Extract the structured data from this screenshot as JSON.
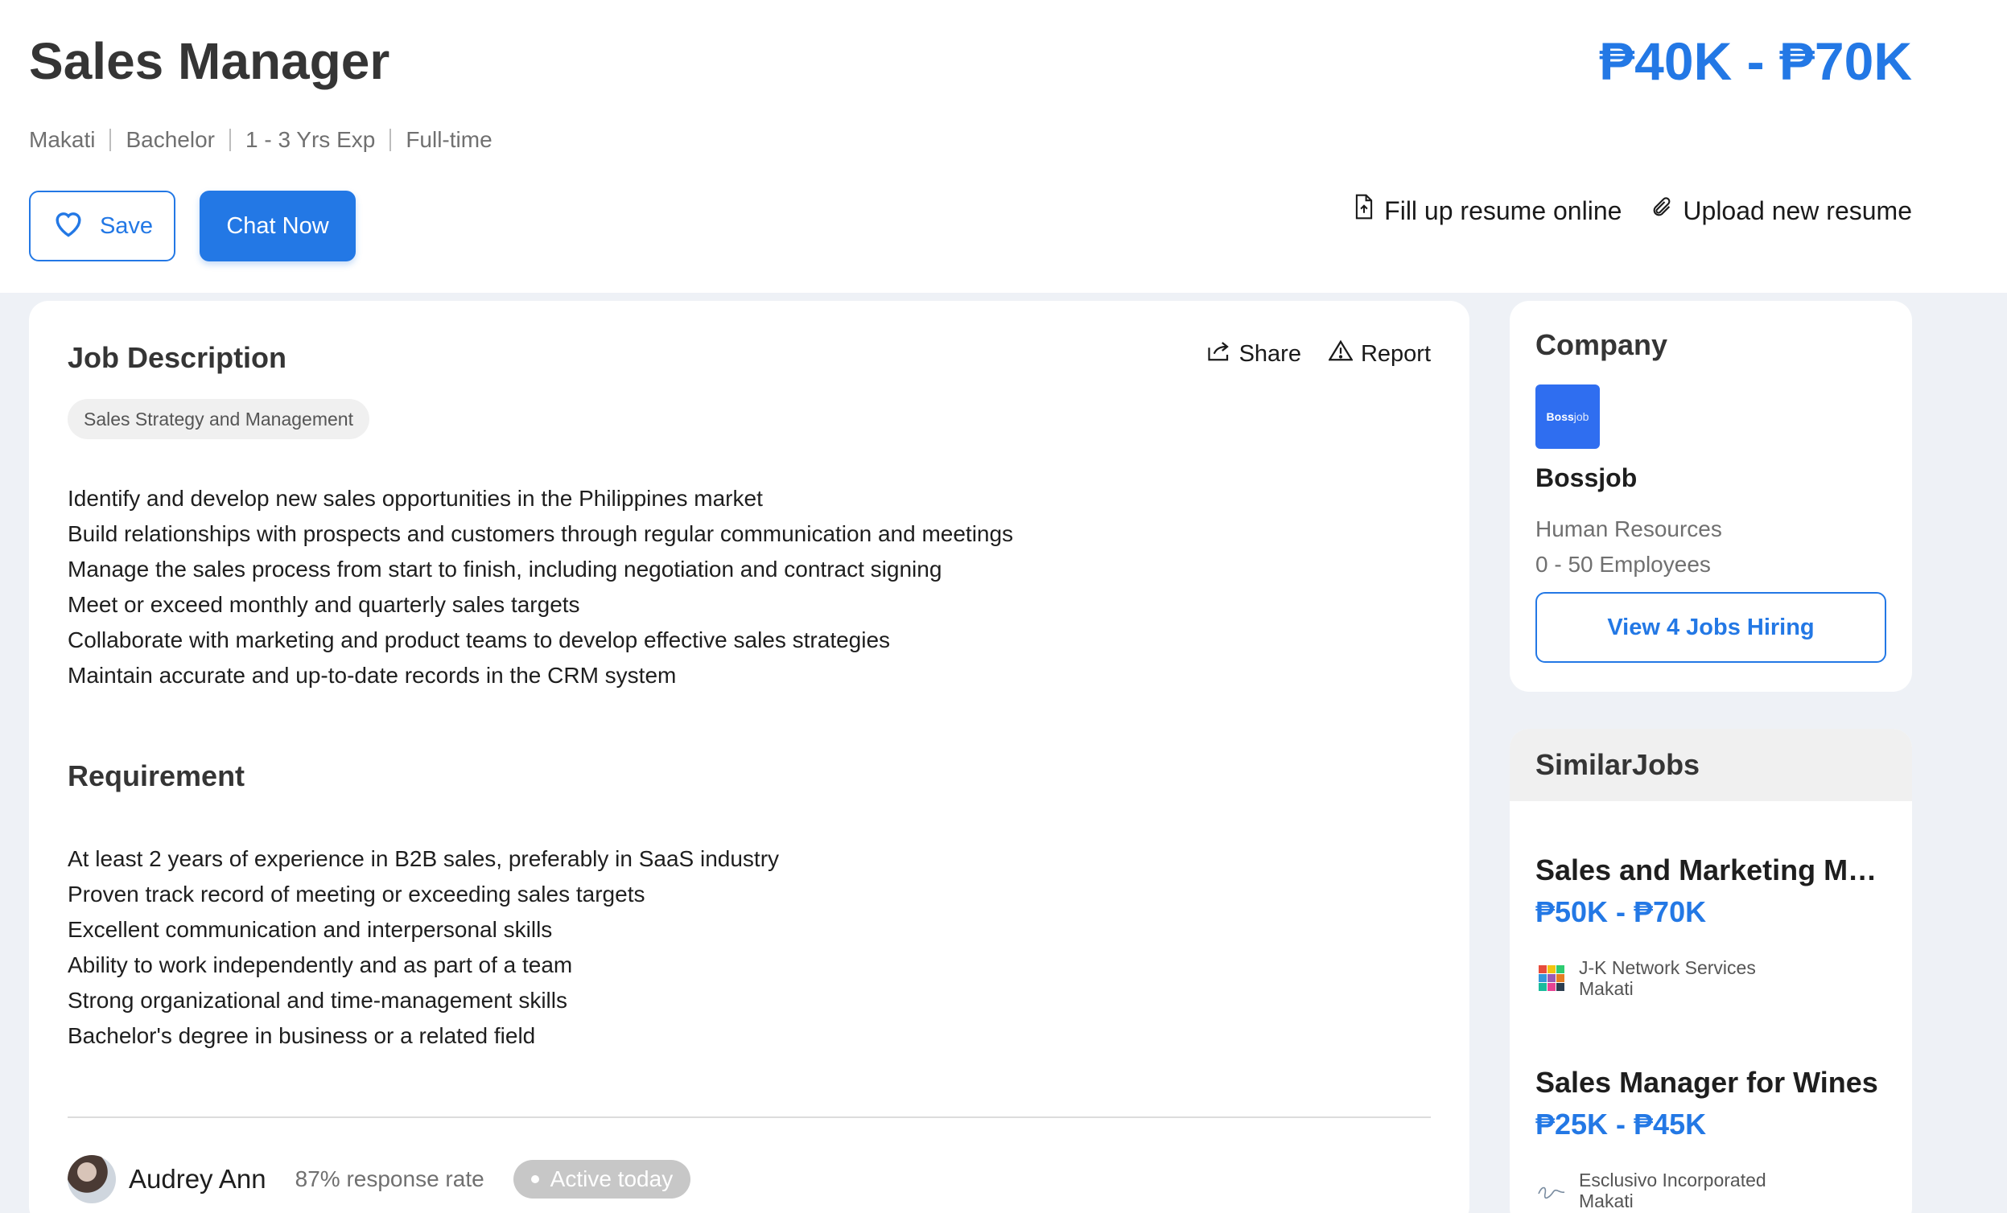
{
  "job": {
    "title": "Sales Manager",
    "salary": "₱40K - ₱70K",
    "meta": [
      "Makati",
      "Bachelor",
      "1 - 3 Yrs Exp",
      "Full-time"
    ],
    "save_label": "Save",
    "chat_label": "Chat Now",
    "fill_resume_label": "Fill up resume online",
    "upload_resume_label": "Upload new resume"
  },
  "description": {
    "title": "Job Description",
    "share_label": "Share",
    "report_label": "Report",
    "tag": "Sales Strategy and Management",
    "lines": [
      "Identify and develop new sales opportunities in the Philippines market",
      "Build relationships with prospects and customers through regular communication and meetings",
      "Manage the sales process from start to finish, including negotiation and contract signing",
      "Meet or exceed monthly and quarterly sales targets",
      "Collaborate with marketing and product teams to develop effective sales strategies",
      "Maintain accurate and up-to-date records in the CRM system"
    ]
  },
  "requirement": {
    "title": "Requirement",
    "lines": [
      "At least 2 years of experience in B2B sales, preferably in SaaS industry",
      "Proven track record of meeting or exceeding sales targets",
      "Excellent communication and interpersonal skills",
      "Ability to work independently and as part of a team",
      "Strong organizational and time-management skills",
      "Bachelor's degree in business or a related field"
    ]
  },
  "recruiter": {
    "name": "Audrey Ann",
    "response_rate": "87%",
    "response_label": "response rate",
    "status": "Active today"
  },
  "company": {
    "heading": "Company",
    "logo_bold": "Boss",
    "logo_light": "job",
    "name": "Bossjob",
    "industry": "Human Resources",
    "size": "0 - 50 Employees",
    "view_jobs_label": "View 4 Jobs Hiring"
  },
  "similar": {
    "heading": "SimilarJobs",
    "items": [
      {
        "title": "Sales and Marketing Manager",
        "salary": "₱50K - ₱70K",
        "company": "J-K Network Services",
        "location": "Makati"
      },
      {
        "title": "Sales Manager for Wines",
        "salary": "₱25K - ₱45K",
        "company": "Esclusivo Incorporated",
        "location": "Makati"
      }
    ]
  },
  "colors": {
    "accent": "#2378e5",
    "page_bg": "#eef1f6",
    "badge_gray": "#c7c7c7"
  }
}
